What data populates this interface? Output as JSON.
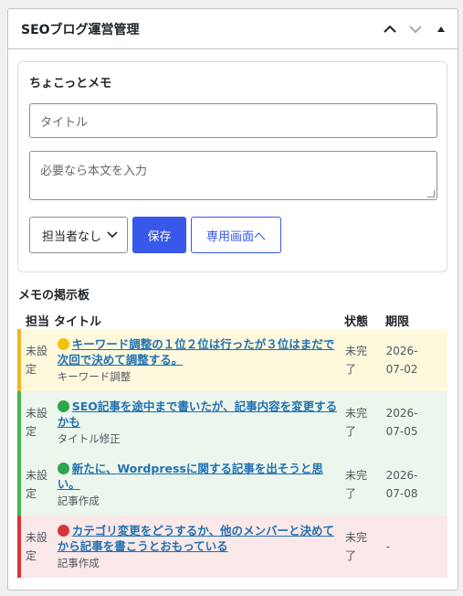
{
  "widget": {
    "title": "SEOブログ運営管理"
  },
  "memo": {
    "heading": "ちょこっとメモ",
    "title_placeholder": "タイトル",
    "body_placeholder": "必要なら本文を入力",
    "assignee_selected": "担当者なし",
    "save_label": "保存",
    "dedicated_label": "専用画面へ"
  },
  "board": {
    "title": "メモの掲示板",
    "columns": [
      "担当",
      "タイトル",
      "状態",
      "期限"
    ],
    "rows": [
      {
        "assignee": "未設定",
        "title": "キーワード調整の１位２位は行ったが３位はまだで次回で決めて調整する。",
        "category": "キーワード調整",
        "status": "未完了",
        "deadline": "2026-07-02",
        "dot_color": "#f4c20d",
        "bar_color": "#f0b429",
        "bg_color": "#fef8dd"
      },
      {
        "assignee": "未設定",
        "title": "SEO記事を途中まで書いたが、記事内容を変更するかも",
        "category": "タイトル修正",
        "status": "未完了",
        "deadline": "2026-07-05",
        "dot_color": "#2ea44f",
        "bar_color": "#46b450",
        "bg_color": "#ecf6ec"
      },
      {
        "assignee": "未設定",
        "title": "新たに、Wordpressに関する記事を出そうと思い。",
        "category": "記事作成",
        "status": "未完了",
        "deadline": "2026-07-08",
        "dot_color": "#2ea44f",
        "bar_color": "#46b450",
        "bg_color": "#ecf6ec"
      },
      {
        "assignee": "未設定",
        "title": "カテゴリ変更をどうするか、他のメンバーと決めてから記事を書こうとおもっている",
        "category": "記事作成",
        "status": "未完了",
        "deadline": "-",
        "dot_color": "#d63638",
        "bar_color": "#d63638",
        "bg_color": "#fbe8e8"
      }
    ]
  },
  "icons": {
    "collapse_up": "chevron-up-icon",
    "collapse_down": "chevron-down-icon",
    "toggle": "triangle-up-icon",
    "select_arrow": "chevron-down-icon"
  }
}
